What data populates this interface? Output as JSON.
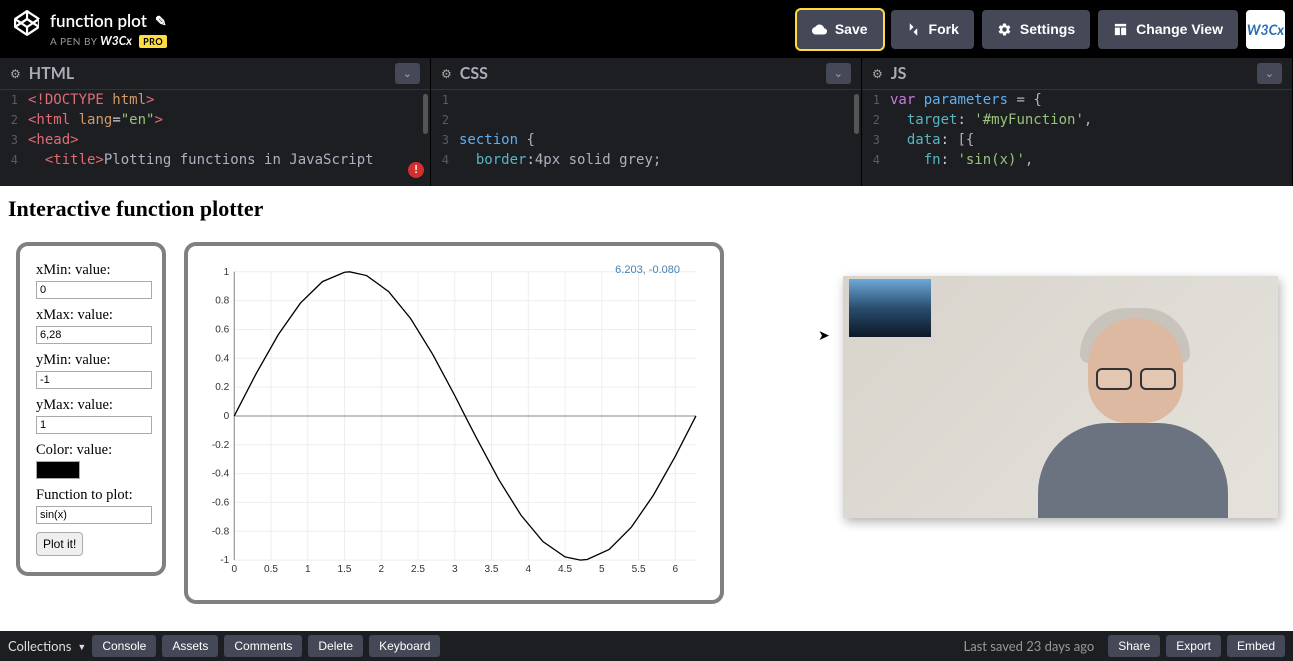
{
  "header": {
    "pen_title": "function plot",
    "byline_prefix": "A PEN BY",
    "author": "W3Cx",
    "pro_badge": "PRO",
    "actions": {
      "save": "Save",
      "fork": "Fork",
      "settings": "Settings",
      "change_view": "Change View"
    },
    "avatar_text": "W3Cx"
  },
  "editors": {
    "html": {
      "title": "HTML",
      "lines": [
        {
          "n": "1",
          "html": "<span class='tag'>&lt;!DOCTYPE</span> <span class='attr'>html</span><span class='tag'>&gt;</span>"
        },
        {
          "n": "2",
          "html": "<span class='tag'>&lt;html</span> <span class='attr'>lang</span>=<span class='str'>\"en\"</span><span class='tag'>&gt;</span>"
        },
        {
          "n": "3",
          "html": "<span class='tag'>&lt;head&gt;</span>"
        },
        {
          "n": "4",
          "html": "  <span class='tag'>&lt;title&gt;</span><span class='txt'>Plotting functions in JavaScript</span>"
        }
      ]
    },
    "css": {
      "title": "CSS",
      "lines": [
        {
          "n": "1",
          "html": ""
        },
        {
          "n": "2",
          "html": ""
        },
        {
          "n": "3",
          "html": "<span class='ident'>section</span> <span class='txt'>{</span>"
        },
        {
          "n": "4",
          "html": "  <span class='prop'>border</span>:<span class='txt'>4px solid grey;</span>"
        }
      ]
    },
    "js": {
      "title": "JS",
      "lines": [
        {
          "n": "1",
          "html": "<span class='kw'>var</span> <span class='ident'>parameters</span> <span class='txt'>= {</span>"
        },
        {
          "n": "2",
          "html": "  <span class='prop'>target</span>: <span class='str'>'#myFunction'</span><span class='txt'>,</span>"
        },
        {
          "n": "3",
          "html": "  <span class='prop'>data</span>: <span class='txt'>[{</span>"
        },
        {
          "n": "4",
          "html": "    <span class='prop'>fn</span>: <span class='str'>'sin(x)'</span><span class='txt'>,</span>"
        }
      ]
    }
  },
  "preview": {
    "heading": "Interactive function plotter",
    "coords_label": "6.203, -0.080",
    "controls": {
      "xmin_label": "xMin: value:",
      "xmin_value": "0",
      "xmax_label": "xMax: value:",
      "xmax_value": "6,28",
      "ymin_label": "yMin: value:",
      "ymin_value": "-1",
      "ymax_label": "yMax: value:",
      "ymax_value": "1",
      "color_label": "Color: value:",
      "fn_label": "Function to plot:",
      "fn_value": "sin(x)",
      "plot_btn": "Plot it!"
    }
  },
  "footer": {
    "collections": "Collections",
    "console": "Console",
    "assets": "Assets",
    "comments": "Comments",
    "delete": "Delete",
    "keyboard": "Keyboard",
    "last_saved": "Last saved 23 days ago",
    "share": "Share",
    "export": "Export",
    "embed": "Embed"
  },
  "chart_data": {
    "type": "line",
    "title": "",
    "xlabel": "",
    "ylabel": "",
    "xlim": [
      0,
      6.28
    ],
    "ylim": [
      -1,
      1
    ],
    "x_ticks": [
      0,
      0.5,
      1,
      1.5,
      2,
      2.5,
      3,
      3.5,
      4,
      4.5,
      5,
      5.5,
      6
    ],
    "y_ticks": [
      -1,
      -0.8,
      -0.6,
      -0.4,
      -0.2,
      0,
      0.2,
      0.4,
      0.6,
      0.8,
      1
    ],
    "series": [
      {
        "name": "sin(x)",
        "color": "#000000",
        "x": [
          0,
          0.3,
          0.6,
          0.9,
          1.2,
          1.5,
          1.57,
          1.8,
          2.1,
          2.4,
          2.7,
          3.0,
          3.14,
          3.3,
          3.6,
          3.9,
          4.2,
          4.5,
          4.71,
          4.8,
          5.1,
          5.4,
          5.7,
          6.0,
          6.28
        ],
        "y": [
          0,
          0.296,
          0.565,
          0.783,
          0.932,
          0.997,
          1.0,
          0.974,
          0.863,
          0.675,
          0.427,
          0.141,
          0.0,
          -0.158,
          -0.443,
          -0.688,
          -0.872,
          -0.978,
          -1.0,
          -0.996,
          -0.926,
          -0.773,
          -0.551,
          -0.279,
          0.0
        ]
      }
    ]
  }
}
